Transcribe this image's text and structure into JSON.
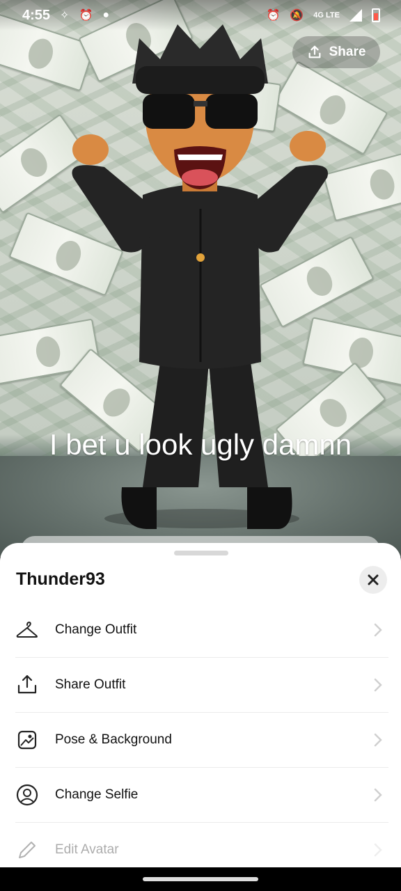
{
  "status_bar": {
    "time": "4:55",
    "left_icons": [
      "sparkle-icon",
      "alarm-icon",
      "snapchat-icon"
    ],
    "right_icons": [
      "alarm-icon",
      "mute-icon",
      "network-4g-lte",
      "signal-icon",
      "battery-low-icon"
    ],
    "network": "4G LTE"
  },
  "share": {
    "label": "Share",
    "icon": "upload-icon"
  },
  "caption": {
    "text": "I bet u look ugly damnn"
  },
  "sheet": {
    "title": "Thunder93",
    "close_icon": "close-icon",
    "items": [
      {
        "label": "Change Outfit",
        "icon": "hanger-icon"
      },
      {
        "label": "Share Outfit",
        "icon": "share-upload-icon"
      },
      {
        "label": "Pose & Background",
        "icon": "image-pose-icon"
      },
      {
        "label": "Change Selfie",
        "icon": "selfie-face-icon"
      },
      {
        "label": "Edit Avatar",
        "icon": "pencil-icon"
      }
    ]
  },
  "colors": {
    "sheet_bg": "#ffffff",
    "text": "#111111",
    "close_bg": "#ededed"
  }
}
